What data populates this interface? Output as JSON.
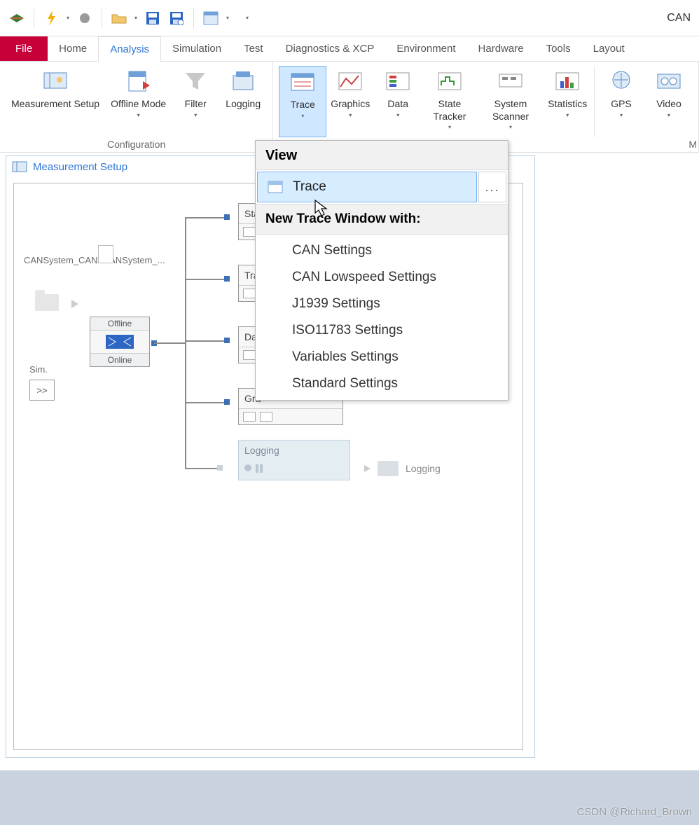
{
  "app_title_fragment": "CAN",
  "tabs": {
    "file": "File",
    "list": [
      "Home",
      "Analysis",
      "Simulation",
      "Test",
      "Diagnostics & XCP",
      "Environment",
      "Hardware",
      "Tools",
      "Layout"
    ],
    "active": "Analysis"
  },
  "ribbon": {
    "configuration": {
      "label": "Configuration",
      "items": [
        "Measurement Setup",
        "Offline Mode",
        "Filter",
        "Logging"
      ]
    },
    "main_group_label_fragment": "M",
    "items": [
      "Trace",
      "Graphics",
      "Data",
      "State Tracker",
      "System Scanner",
      "Statistics",
      "GPS",
      "Video"
    ],
    "active": "Trace"
  },
  "panel": {
    "title": "Measurement Setup",
    "canSystem": "CANSystem_CAN1CANSystem_...",
    "sim": "Sim.",
    "sim_arrows": ">>",
    "offline": "Offline",
    "online": "Online",
    "nodes": [
      "Sta",
      "Tra",
      "Dat",
      "Gra"
    ],
    "logging": "Logging",
    "logging_out": "Logging"
  },
  "popup": {
    "view": "View",
    "trace": "Trace",
    "more": "...",
    "subhead": "New Trace Window with:",
    "options": [
      "CAN Settings",
      "CAN Lowspeed Settings",
      "J1939 Settings",
      "ISO11783 Settings",
      "Variables Settings",
      "Standard Settings"
    ]
  },
  "watermark": "CSDN @Richard_Brown"
}
